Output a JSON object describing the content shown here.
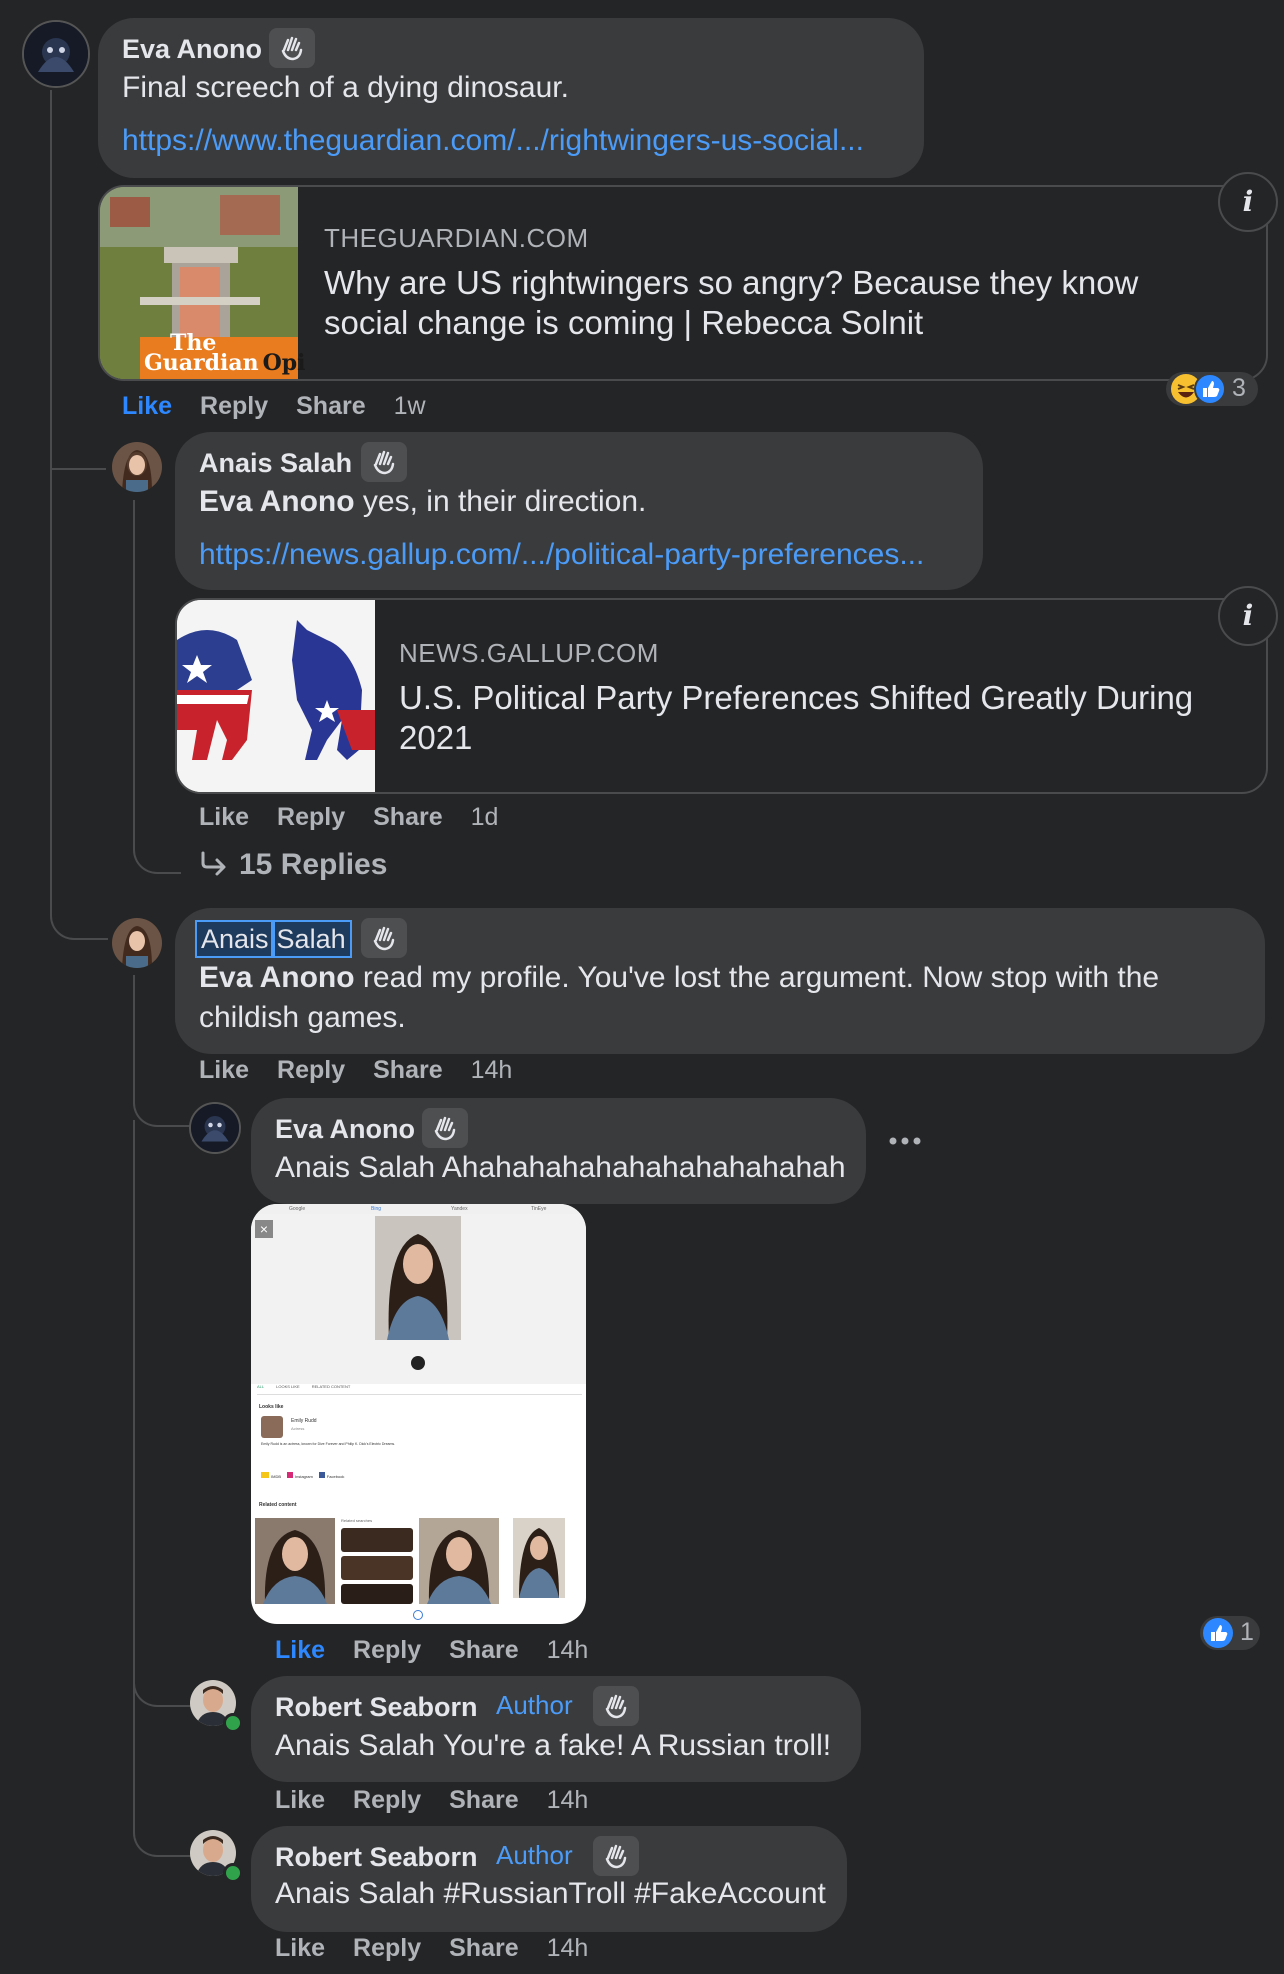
{
  "comments": [
    {
      "author": "Eva Anono",
      "text": "Final screech of a dying dinosaur.",
      "link": "https://www.theguardian.com/.../rightwingers-us-social...",
      "card": {
        "domain": "THEGUARDIAN.COM",
        "title_line1": "Why are US rightwingers so angry? Because they know",
        "title_line2": "social change is coming | Rebecca Solnit",
        "thumb_text_1": "The",
        "thumb_text_2": "Guardian",
        "thumb_text_3": "Opi"
      },
      "actions": {
        "like": "Like",
        "reply": "Reply",
        "share": "Share",
        "time": "1w"
      },
      "reaction_count": "3"
    },
    {
      "author": "Anais Salah",
      "mention": "Eva Anono",
      "text": "yes, in their direction.",
      "link": "https://news.gallup.com/.../political-party-preferences...",
      "card": {
        "domain": "NEWS.GALLUP.COM",
        "title_line1": "U.S. Political Party Preferences Shifted Greatly During",
        "title_line2": "2021"
      },
      "actions": {
        "like": "Like",
        "reply": "Reply",
        "share": "Share",
        "time": "1d"
      },
      "replies_label": "15 Replies"
    },
    {
      "author_first": "Anais",
      "author_last": "Salah",
      "mention": "Eva Anono",
      "text_line1": "read my profile. You've lost the argument. Now stop with the",
      "text_line2": "childish games.",
      "actions": {
        "like": "Like",
        "reply": "Reply",
        "share": "Share",
        "time": "14h"
      }
    },
    {
      "author": "Eva Anono",
      "text": "Anais Salah Ahahahahahahahahahahahah",
      "screenshot_tabs": [
        "Google",
        "Bing",
        "Yandex",
        "TinEye"
      ],
      "screenshot_subtabs": [
        "ALL",
        "LOOKS LIKE",
        "RELATED CONTENT"
      ],
      "screenshot_looks_like": "Looks like",
      "screenshot_person_name": "Emily Rudd",
      "screenshot_person_role": "Actress",
      "screenshot_person_desc": "Emily Rudd is an actress, known for Dive Forever and Philip K. Dick's Electric Dreams.",
      "screenshot_links": [
        "IMDB",
        "Instagram",
        "Facebook"
      ],
      "screenshot_related": "Related content",
      "screenshot_related_searches": "Related searches",
      "actions": {
        "like": "Like",
        "reply": "Reply",
        "share": "Share",
        "time": "14h"
      },
      "reaction_count": "1"
    },
    {
      "author": "Robert Seaborn",
      "badge": "Author",
      "text": "Anais Salah You're a fake! A Russian troll!",
      "actions": {
        "like": "Like",
        "reply": "Reply",
        "share": "Share",
        "time": "14h"
      }
    },
    {
      "author": "Robert Seaborn",
      "badge": "Author",
      "text": "Anais Salah #RussianTroll #FakeAccount",
      "actions": {
        "like": "Like",
        "reply": "Reply",
        "share": "Share",
        "time": "14h"
      }
    }
  ],
  "colors": {
    "background": "#242526",
    "bubble": "#3a3b3c",
    "link": "#4b9bf8",
    "like_active": "#2d88ff",
    "muted": "#b0b3b8"
  }
}
